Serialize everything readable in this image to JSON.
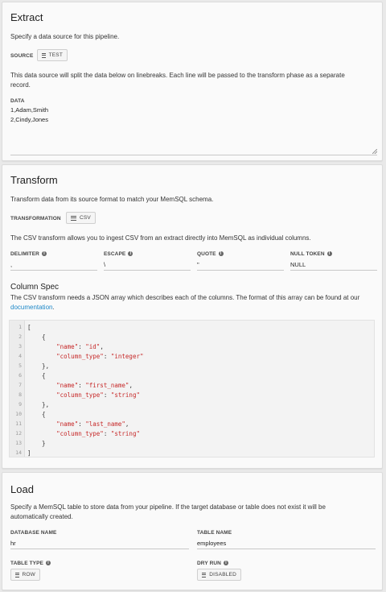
{
  "extract": {
    "title": "Extract",
    "description": "Specify a data source for this pipeline.",
    "source_label": "SOURCE",
    "source_button": "TEST",
    "note_line1": "This data source will split the data below on linebreaks. Each line will be passed to the transform phase as a separate",
    "note_line2": "record.",
    "data_label": "DATA",
    "data_lines": [
      "1,Adam,Smith",
      "2,Cindy,Jones"
    ]
  },
  "transform": {
    "title": "Transform",
    "description": "Transform data from its source format to match your MemSQL schema.",
    "transformation_label": "TRANSFORMATION",
    "transformation_button": "CSV",
    "csv_note": "The CSV transform allows you to ingest CSV from an extract directly into MemSQL as individual columns.",
    "fields": [
      {
        "label": "DELIMITER",
        "value": ","
      },
      {
        "label": "ESCAPE",
        "value": "\\"
      },
      {
        "label": "QUOTE",
        "value": "\""
      },
      {
        "label": "NULL TOKEN",
        "value": "NULL"
      }
    ],
    "column_spec_title": "Column Spec",
    "column_spec_line1": "The CSV transform needs a JSON array which describes each of the columns. The format of this array can be found at our",
    "column_spec_link": "documentation",
    "column_spec_end": "."
  },
  "code": {
    "lines": [
      {
        "n": "1",
        "parts": [
          {
            "t": "["
          }
        ]
      },
      {
        "n": "2",
        "parts": [
          {
            "t": "    {"
          }
        ]
      },
      {
        "n": "3",
        "parts": [
          {
            "t": "        "
          },
          {
            "t": "\"name\"",
            "s": 1
          },
          {
            "t": ": "
          },
          {
            "t": "\"id\"",
            "s": 1
          },
          {
            "t": ","
          }
        ]
      },
      {
        "n": "4",
        "parts": [
          {
            "t": "        "
          },
          {
            "t": "\"column_type\"",
            "s": 1
          },
          {
            "t": ": "
          },
          {
            "t": "\"integer\"",
            "s": 1
          }
        ]
      },
      {
        "n": "5",
        "parts": [
          {
            "t": "    },"
          }
        ]
      },
      {
        "n": "6",
        "parts": [
          {
            "t": "    {"
          }
        ]
      },
      {
        "n": "7",
        "parts": [
          {
            "t": "        "
          },
          {
            "t": "\"name\"",
            "s": 1
          },
          {
            "t": ": "
          },
          {
            "t": "\"first_name\"",
            "s": 1
          },
          {
            "t": ","
          }
        ]
      },
      {
        "n": "8",
        "parts": [
          {
            "t": "        "
          },
          {
            "t": "\"column_type\"",
            "s": 1
          },
          {
            "t": ": "
          },
          {
            "t": "\"string\"",
            "s": 1
          }
        ]
      },
      {
        "n": "9",
        "parts": [
          {
            "t": "    },"
          }
        ]
      },
      {
        "n": "10",
        "parts": [
          {
            "t": "    {"
          }
        ]
      },
      {
        "n": "11",
        "parts": [
          {
            "t": "        "
          },
          {
            "t": "\"name\"",
            "s": 1
          },
          {
            "t": ": "
          },
          {
            "t": "\"last_name\"",
            "s": 1
          },
          {
            "t": ","
          }
        ]
      },
      {
        "n": "12",
        "parts": [
          {
            "t": "        "
          },
          {
            "t": "\"column_type\"",
            "s": 1
          },
          {
            "t": ": "
          },
          {
            "t": "\"string\"",
            "s": 1
          }
        ]
      },
      {
        "n": "13",
        "parts": [
          {
            "t": "    }"
          }
        ]
      },
      {
        "n": "14",
        "parts": [
          {
            "t": "]"
          }
        ]
      }
    ]
  },
  "load": {
    "title": "Load",
    "description_line1": "Specify a MemSQL table to store data from your pipeline. If the target database or table does not exist it will be",
    "description_line2": "automatically created.",
    "database_label": "DATABASE NAME",
    "database_value": "hr",
    "table_label": "TABLE NAME",
    "table_value": "employees",
    "table_type_label": "TABLE TYPE",
    "table_type_button": "ROW",
    "dry_run_label": "DRY RUN",
    "dry_run_button": "DISABLED"
  },
  "colors": {
    "link": "#1e88c8",
    "string": "#c62828",
    "background": "#e9e9e9",
    "card": "#fafafa"
  }
}
